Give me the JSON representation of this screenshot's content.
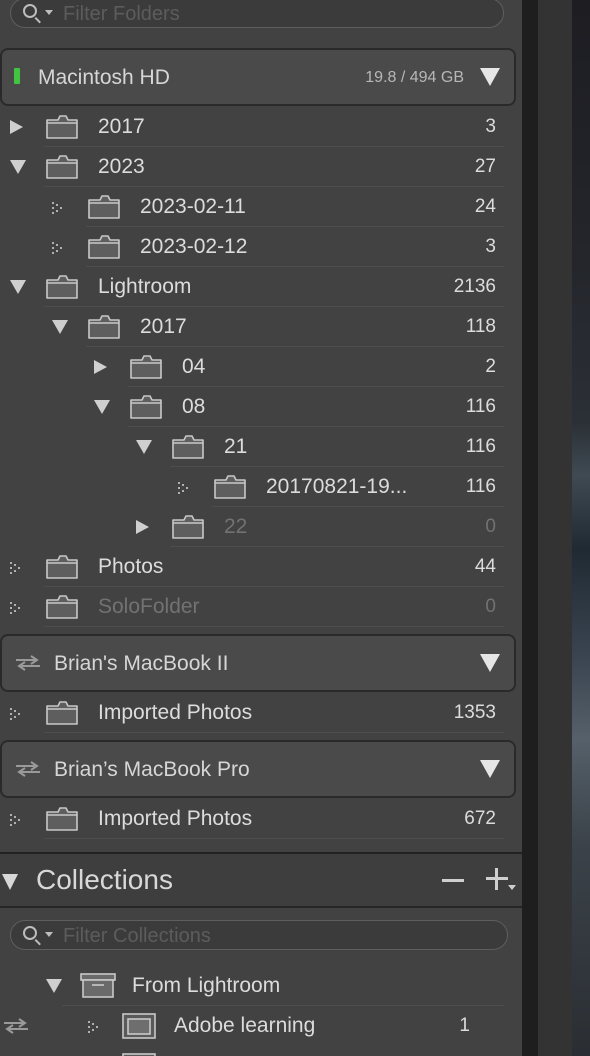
{
  "folders_filter": {
    "placeholder": "Filter Folders"
  },
  "volumes": [
    {
      "name": "Macintosh HD",
      "capacity": "19.8 / 494 GB",
      "status_color": "#3fc53f"
    },
    {
      "name": "Brian's MacBook II"
    },
    {
      "name": "Brian’s MacBook Pro"
    }
  ],
  "folders": [
    {
      "label": "2017",
      "count": "3"
    },
    {
      "label": "2023",
      "count": "27"
    },
    {
      "label": "2023-02-11",
      "count": "24"
    },
    {
      "label": "2023-02-12",
      "count": "3"
    },
    {
      "label": "Lightroom",
      "count": "2136"
    },
    {
      "label": "2017",
      "count": "118"
    },
    {
      "label": "04",
      "count": "2"
    },
    {
      "label": "08",
      "count": "116"
    },
    {
      "label": "21",
      "count": "116"
    },
    {
      "label": "20170821-19...",
      "count": "116"
    },
    {
      "label": "22",
      "count": "0"
    },
    {
      "label": "Photos",
      "count": "44"
    },
    {
      "label": "SoloFolder",
      "count": "0"
    },
    {
      "label": "Imported Photos",
      "count": "1353"
    },
    {
      "label": "Imported Photos",
      "count": "672"
    }
  ],
  "collections": {
    "title": "Collections",
    "filter_placeholder": "Filter Collections",
    "items": [
      {
        "label": "From Lightroom",
        "count": ""
      },
      {
        "label": "Adobe learning",
        "count": "1"
      }
    ]
  }
}
